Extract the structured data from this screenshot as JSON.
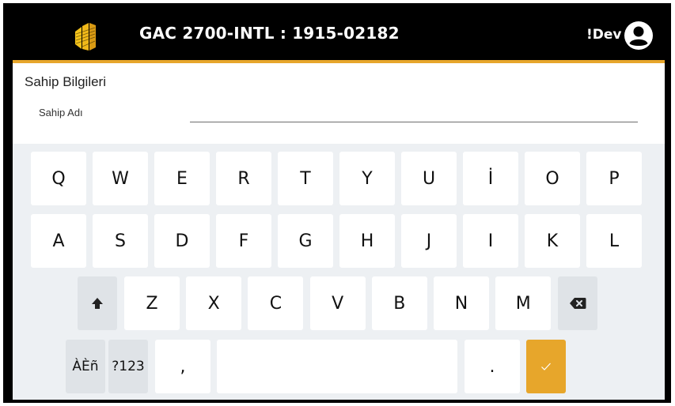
{
  "app_bar": {
    "title": "GAC 2700-INTL : 1915-02182",
    "user_label": "!Dev",
    "logo_icon": "gac-logo-icon",
    "account_icon": "account-circle-icon"
  },
  "form": {
    "section_title": "Sahip Bilgileri",
    "field_label": "Sahip Adı",
    "field_value": ""
  },
  "keyboard": {
    "row1": [
      "Q",
      "W",
      "E",
      "R",
      "T",
      "Y",
      "U",
      "İ",
      "O",
      "P"
    ],
    "row2": [
      "A",
      "S",
      "D",
      "F",
      "G",
      "H",
      "J",
      "I",
      "K",
      "L"
    ],
    "row3": [
      "Z",
      "X",
      "C",
      "V",
      "B",
      "N",
      "M"
    ],
    "shift_icon": "shift-arrow-icon",
    "backspace_icon": "backspace-icon",
    "enter_icon": "checkmark-icon",
    "accents_label": "ÀÈñ",
    "symbols_label": "?123",
    "comma_label": ",",
    "period_label": "."
  },
  "colors": {
    "accent": "#e7a62b",
    "app_bar": "#000000",
    "keyboard_bg": "#edf0f3"
  }
}
